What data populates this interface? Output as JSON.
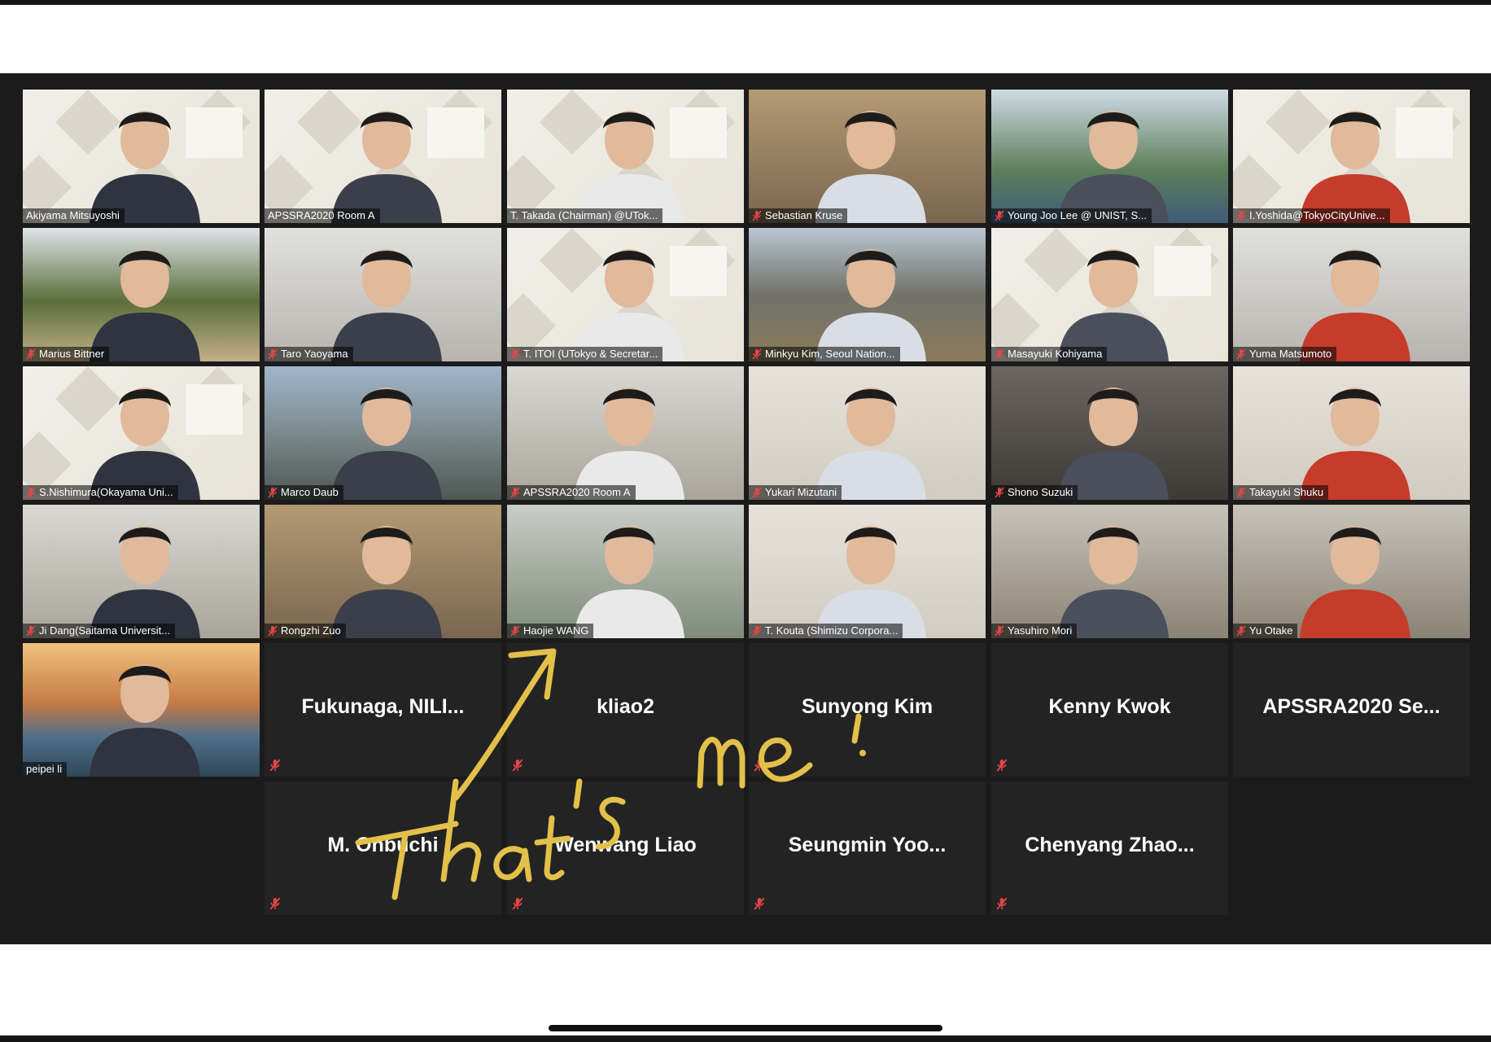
{
  "meeting": {
    "annotation_text": "That's me!",
    "annotation_color": "#e3c04a",
    "active_speaker_color": "#c6df59",
    "muted_icon": "muted-mic-icon"
  },
  "participants": [
    {
      "name": "Akiyama Mitsuyoshi",
      "video": true,
      "muted": false,
      "bg": "slide"
    },
    {
      "name": "APSSRA2020 Room A",
      "video": true,
      "muted": false,
      "bg": "slide",
      "active": true
    },
    {
      "name": "T. Takada (Chairman) @UTok...",
      "video": true,
      "muted": false,
      "bg": "slide"
    },
    {
      "name": "Sebastian Kruse",
      "video": true,
      "muted": true,
      "bg": "room"
    },
    {
      "name": "Young Joo Lee @ UNIST, S...",
      "video": true,
      "muted": true,
      "bg": "campus"
    },
    {
      "name": "I.Yoshida@TokyoCityUnive...",
      "video": true,
      "muted": true,
      "bg": "slide"
    },
    {
      "name": "Marius Bittner",
      "video": true,
      "muted": true,
      "bg": "park"
    },
    {
      "name": "Taro Yaoyama",
      "video": true,
      "muted": true,
      "bg": "office"
    },
    {
      "name": "T. ITOI (UTokyo & Secretar...",
      "video": true,
      "muted": true,
      "bg": "slide"
    },
    {
      "name": "Minkyu Kim, Seoul Nation...",
      "video": true,
      "muted": true,
      "bg": "mountain"
    },
    {
      "name": "Masayuki Kohiyama",
      "video": true,
      "muted": true,
      "bg": "slide"
    },
    {
      "name": "Yuma Matsumoto",
      "video": true,
      "muted": true,
      "bg": "office"
    },
    {
      "name": "S.Nishimura(Okayama Uni...",
      "video": true,
      "muted": true,
      "bg": "slide"
    },
    {
      "name": "Marco Daub",
      "video": true,
      "muted": true,
      "bg": "street"
    },
    {
      "name": "APSSRA2020 Room A",
      "video": true,
      "muted": true,
      "bg": "lab"
    },
    {
      "name": "Yukari Mizutani",
      "video": true,
      "muted": true,
      "bg": "wall"
    },
    {
      "name": "Shono Suzuki",
      "video": true,
      "muted": true,
      "bg": "dark"
    },
    {
      "name": "Takayuki Shuku",
      "video": true,
      "muted": true,
      "bg": "wall"
    },
    {
      "name": "Ji Dang(Saitama Universit...",
      "video": true,
      "muted": true,
      "bg": "lab"
    },
    {
      "name": "Rongzhi Zuo",
      "video": true,
      "muted": true,
      "bg": "room"
    },
    {
      "name": "Haojie WANG",
      "video": true,
      "muted": true,
      "bg": "window"
    },
    {
      "name": "T. Kouta (Shimizu Corpora...",
      "video": true,
      "muted": true,
      "bg": "wall"
    },
    {
      "name": "Yasuhiro Mori",
      "video": true,
      "muted": true,
      "bg": "shelves"
    },
    {
      "name": "Yu Otake",
      "video": true,
      "muted": true,
      "bg": "shelves"
    },
    {
      "name": "peipei li",
      "video": true,
      "muted": false,
      "bg": "bridge"
    },
    {
      "name": "Fukunaga,  NILI...",
      "video": false,
      "muted": true
    },
    {
      "name": "kliao2",
      "video": false,
      "muted": true
    },
    {
      "name": "Sunyong Kim",
      "video": false,
      "muted": true
    },
    {
      "name": "Kenny Kwok",
      "video": false,
      "muted": true
    },
    {
      "name": "APSSRA2020  Se...",
      "video": false,
      "muted": false
    },
    {
      "name": "M. Ohbuchi",
      "video": false,
      "muted": true
    },
    {
      "name": "Wenwang Liao",
      "video": false,
      "muted": true
    },
    {
      "name": "Seungmin  Yoo...",
      "video": false,
      "muted": true
    },
    {
      "name": "Chenyang  Zhao...",
      "video": false,
      "muted": true
    }
  ]
}
